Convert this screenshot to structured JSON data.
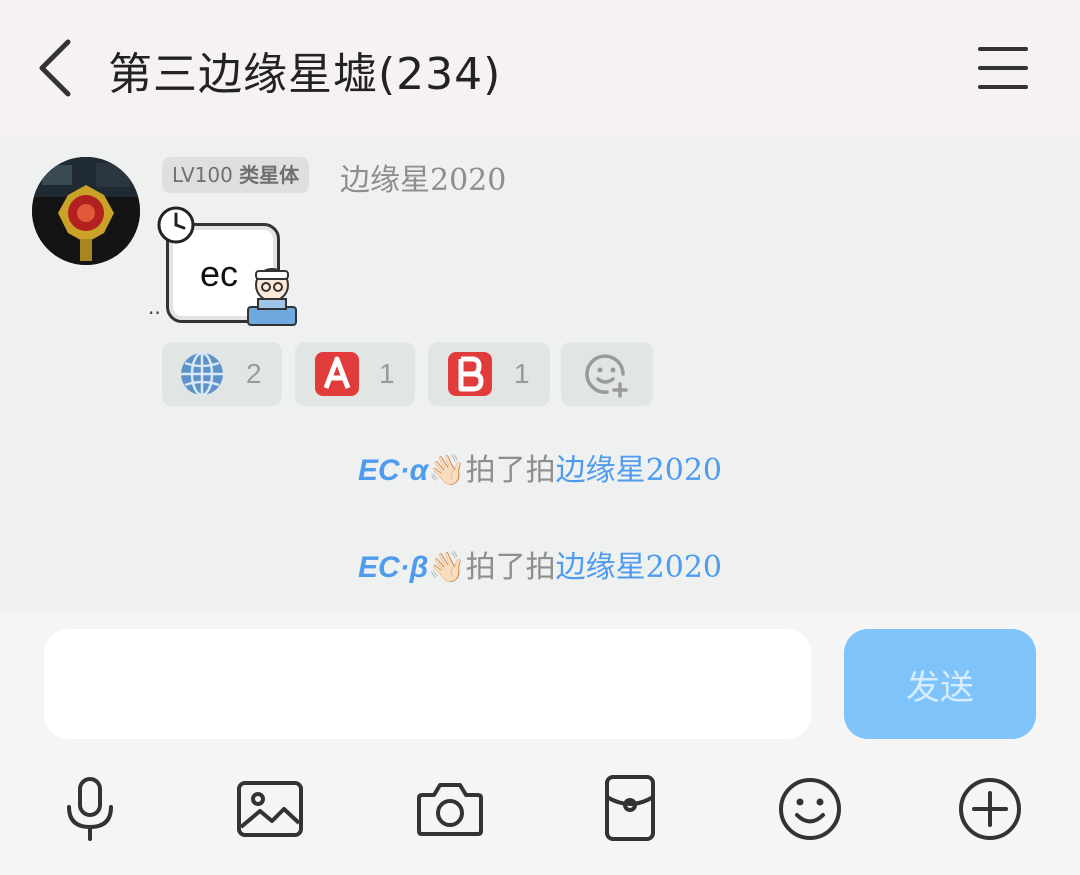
{
  "header": {
    "title": "第三边缘星墟(234)"
  },
  "message": {
    "level_prefix": "LV100",
    "level_title": "类星体",
    "sender_name": "边缘星2020",
    "text": "ec",
    "reactions": [
      {
        "icon": "globe-icon",
        "count": "2"
      },
      {
        "icon": "letter-a-icon",
        "count": "1"
      },
      {
        "icon": "letter-b-icon",
        "count": "1"
      },
      {
        "icon": "add-reaction-icon",
        "count": ""
      }
    ]
  },
  "notices": [
    {
      "actor": "EC·α",
      "emoji": "👋🏻",
      "action": "拍了拍",
      "target": "边缘星2020"
    },
    {
      "actor": "EC·β",
      "emoji": "👋🏻",
      "action": "拍了拍",
      "target": "边缘星2020"
    }
  ],
  "composer": {
    "input_value": "",
    "send_label": "发送",
    "send_color": "#7ec4fb"
  },
  "toolbar": [
    "microphone-icon",
    "image-icon",
    "camera-icon",
    "red-packet-icon",
    "emoji-icon",
    "plus-icon"
  ],
  "colors": {
    "header_bg": "#f6f1f4",
    "chat_bg": "#eef1ef",
    "link_blue": "#4e9bf0"
  }
}
